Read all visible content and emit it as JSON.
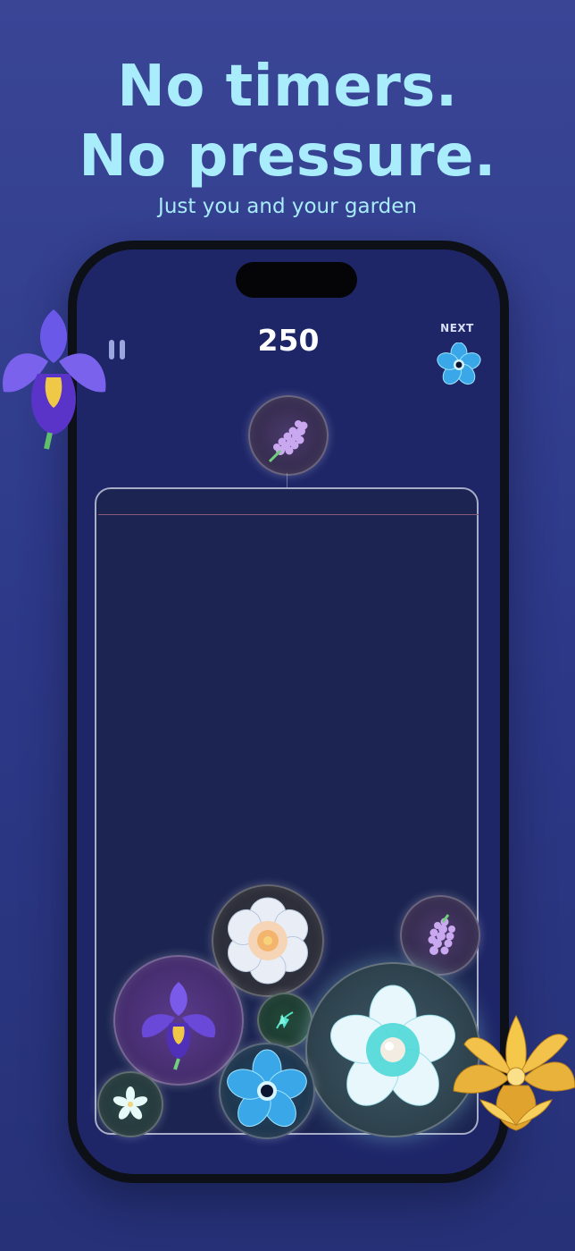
{
  "headline": {
    "line1": "No timers.",
    "line2": "No pressure.",
    "subtitle": "Just you and your garden"
  },
  "game": {
    "score": "250",
    "next_label": "NEXT",
    "next_flower": "anemone-icon",
    "current_flower": "hyacinth-icon"
  },
  "colors": {
    "background": "#2e3a8a",
    "headline": "#a9ecfb",
    "screen": "#1e2668",
    "field": "#1c2552",
    "danger_line": "#8a5a78"
  },
  "board_flowers": [
    "peony-icon",
    "hyacinth-icon",
    "iris-icon",
    "sprout-icon",
    "pearl-lotus-icon",
    "jasmine-icon",
    "anemone-icon"
  ],
  "decorations": [
    "iris-icon",
    "golden-lotus-icon"
  ]
}
